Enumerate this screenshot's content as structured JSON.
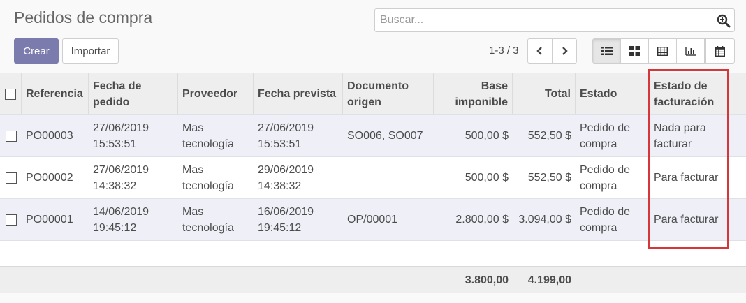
{
  "page": {
    "title": "Pedidos de compra"
  },
  "search": {
    "placeholder": "Buscar...",
    "icon": "search-plus-icon"
  },
  "actions": {
    "create_label": "Crear",
    "import_label": "Importar"
  },
  "pager": {
    "value": "1-3 / 3",
    "prev_icon": "chevron-left-icon",
    "next_icon": "chevron-right-icon"
  },
  "views": [
    {
      "icon": "list-icon",
      "active": true
    },
    {
      "icon": "kanban-icon",
      "active": false
    },
    {
      "icon": "pivot-table-icon",
      "active": false
    },
    {
      "icon": "graph-icon",
      "active": false
    },
    {
      "icon": "calendar-icon",
      "active": false
    }
  ],
  "table": {
    "headers": {
      "referencia": "Referencia",
      "fecha_pedido_l1": "Fecha de",
      "fecha_pedido_l2": "pedido",
      "proveedor": "Proveedor",
      "fecha_prevista": "Fecha prevista",
      "documento_l1": "Documento",
      "documento_l2": "origen",
      "base_l1": "Base",
      "base_l2": "imponible",
      "total": "Total",
      "estado": "Estado",
      "facturacion_l1": "Estado de",
      "facturacion_l2": "facturación"
    },
    "rows": [
      {
        "referencia": "PO00003",
        "fecha_pedido_l1": "27/06/2019",
        "fecha_pedido_l2": "15:53:51",
        "proveedor_l1": "Mas",
        "proveedor_l2": "tecnología",
        "fecha_prevista_l1": "27/06/2019",
        "fecha_prevista_l2": "15:53:51",
        "documento": "SO006, SO007",
        "base": "500,00 $",
        "total": "552,50 $",
        "estado_l1": "Pedido de",
        "estado_l2": "compra",
        "facturacion_l1": "Nada para",
        "facturacion_l2": "facturar"
      },
      {
        "referencia": "PO00002",
        "fecha_pedido_l1": "27/06/2019",
        "fecha_pedido_l2": "14:38:32",
        "proveedor_l1": "Mas",
        "proveedor_l2": "tecnología",
        "fecha_prevista_l1": "29/06/2019",
        "fecha_prevista_l2": "14:38:32",
        "documento": "",
        "base": "500,00 $",
        "total": "552,50 $",
        "estado_l1": "Pedido de",
        "estado_l2": "compra",
        "facturacion_l1": "Para facturar",
        "facturacion_l2": ""
      },
      {
        "referencia": "PO00001",
        "fecha_pedido_l1": "14/06/2019",
        "fecha_pedido_l2": "19:45:12",
        "proveedor_l1": "Mas",
        "proveedor_l2": "tecnología",
        "fecha_prevista_l1": "16/06/2019",
        "fecha_prevista_l2": "19:45:12",
        "documento": "OP/00001",
        "base": "2.800,00 $",
        "total": "3.094,00 $",
        "estado_l1": "Pedido de",
        "estado_l2": "compra",
        "facturacion_l1": "Para facturar",
        "facturacion_l2": ""
      }
    ],
    "totals": {
      "base": "3.800,00",
      "total": "4.199,00"
    }
  },
  "colors": {
    "primary": "#7c7bad",
    "highlight": "#d6353a",
    "row_alt": "#eeeff7",
    "header_bg": "#eeeeee"
  }
}
